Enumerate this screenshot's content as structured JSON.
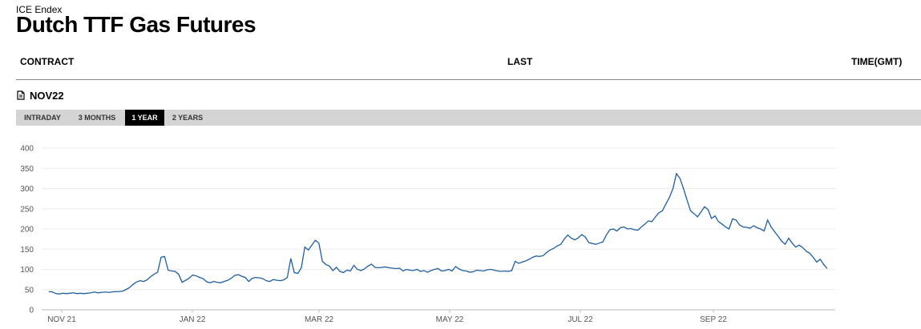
{
  "header": {
    "brand": "ICE Endex",
    "title": "Dutch TTF Gas Futures"
  },
  "table_header": {
    "contract": "CONTRACT",
    "last": "LAST",
    "time": "TIME(GMT)"
  },
  "contract": {
    "name": "NOV22",
    "icon": "document-icon"
  },
  "tabs": [
    {
      "label": "INTRADAY",
      "active": false
    },
    {
      "label": "3 MONTHS",
      "active": false
    },
    {
      "label": "1 YEAR",
      "active": true
    },
    {
      "label": "2 YEARS",
      "active": false
    }
  ],
  "chart_data": {
    "type": "line",
    "title": "",
    "xlabel": "",
    "ylabel": "",
    "ylim": [
      0,
      400
    ],
    "yticks": [
      0,
      50,
      100,
      150,
      200,
      250,
      300,
      350,
      400
    ],
    "xticks": [
      "NOV 21",
      "JAN 22",
      "MAR 22",
      "MAY 22",
      "JUL 22",
      "SEP 22"
    ],
    "grid": true,
    "line_color": "#1f5fa0",
    "series": [
      {
        "values": [
          45,
          44,
          40,
          39,
          41,
          40,
          41,
          42,
          40,
          41,
          40,
          41,
          42,
          44,
          42,
          43,
          44,
          43,
          44,
          45,
          45,
          46,
          50,
          55,
          63,
          69,
          72,
          70,
          74,
          82,
          88,
          93,
          130,
          132,
          98,
          96,
          95,
          88,
          68,
          73,
          78,
          86,
          84,
          80,
          77,
          69,
          67,
          70,
          68,
          67,
          70,
          73,
          78,
          85,
          87,
          83,
          80,
          70,
          78,
          80,
          79,
          77,
          72,
          70,
          75,
          73,
          72,
          74,
          80,
          127,
          92,
          90,
          104,
          155,
          148,
          160,
          172,
          165,
          120,
          112,
          108,
          97,
          105,
          95,
          92,
          98,
          96,
          110,
          100,
          97,
          101,
          108,
          113,
          105,
          104,
          105,
          106,
          104,
          103,
          102,
          103,
          96,
          100,
          98,
          97,
          100,
          95,
          97,
          93,
          97,
          100,
          102,
          96,
          97,
          100,
          96,
          107,
          101,
          97,
          96,
          93,
          94,
          98,
          97,
          96,
          99,
          100,
          98,
          96,
          95,
          96,
          95,
          97,
          120,
          115,
          118,
          121,
          125,
          130,
          133,
          132,
          134,
          142,
          148,
          152,
          158,
          162,
          175,
          185,
          177,
          173,
          178,
          186,
          180,
          166,
          164,
          162,
          165,
          168,
          185,
          198,
          200,
          195,
          203,
          205,
          200,
          201,
          198,
          197,
          205,
          212,
          220,
          218,
          230,
          240,
          245,
          262,
          278,
          300,
          337,
          325,
          300,
          272,
          245,
          238,
          230,
          242,
          255,
          248,
          226,
          232,
          218,
          212,
          205,
          200,
          225,
          222,
          210,
          205,
          204,
          202,
          208,
          203,
          200,
          195,
          222,
          205,
          193,
          182,
          170,
          162,
          177,
          165,
          155,
          160,
          154,
          145,
          140,
          130,
          118,
          125,
          112,
          102
        ]
      }
    ]
  }
}
